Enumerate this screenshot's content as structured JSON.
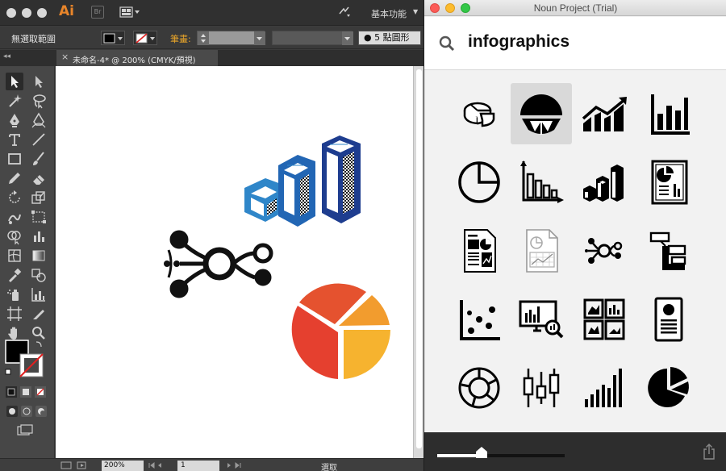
{
  "illustrator": {
    "app_logo": "Ai",
    "bridge_badge": "Br",
    "workspace_label": "基本功能",
    "control_bar": {
      "selection_label": "無選取範圍",
      "stroke_label": "筆畫:",
      "brush_label": "5 點圓形"
    },
    "document_tab": {
      "close_glyph": "×",
      "title": "未命名-4* @ 200% (CMYK/預視)"
    },
    "status_bar": {
      "zoom": "200%",
      "page": "1",
      "status": "選取"
    },
    "artwork": {
      "colors": {
        "bars_blue_light": "#2f86c9",
        "bars_blue_mid": "#2266b4",
        "bars_blue_dark": "#1e3d8f",
        "network": "#111111",
        "pie_red": "#e5402f",
        "pie_orange": "#f29c2e",
        "pie_yellow": "#f6b32f"
      }
    }
  },
  "noun_project": {
    "window_title": "Noun Project (Trial)",
    "search_query": "infographics",
    "icons": [
      {
        "name": "pie-3d-icon",
        "selected": false
      },
      {
        "name": "half-pie-icon",
        "selected": true
      },
      {
        "name": "bar-line-trend-icon",
        "selected": false
      },
      {
        "name": "bar-chart-axis-icon",
        "selected": false
      },
      {
        "name": "pie-outline-icon",
        "selected": false
      },
      {
        "name": "bar-chart-arrow-icon",
        "selected": false
      },
      {
        "name": "3d-bars-icon",
        "selected": false
      },
      {
        "name": "report-document-icon",
        "selected": false
      },
      {
        "name": "document-charts-icon",
        "selected": false
      },
      {
        "name": "faded-document-icon",
        "selected": false
      },
      {
        "name": "network-nodes-icon",
        "selected": false
      },
      {
        "name": "flow-blocks-icon",
        "selected": false
      },
      {
        "name": "scatter-plot-icon",
        "selected": false
      },
      {
        "name": "monitor-magnifier-icon",
        "selected": false
      },
      {
        "name": "dashboard-grid-icon",
        "selected": false
      },
      {
        "name": "profile-report-icon",
        "selected": false
      },
      {
        "name": "donut-chart-icon",
        "selected": false
      },
      {
        "name": "candlestick-icon",
        "selected": false
      },
      {
        "name": "rising-bars-icon",
        "selected": false
      },
      {
        "name": "exploded-pie-icon",
        "selected": false
      }
    ],
    "size_slider": {
      "value": 0.35
    }
  }
}
